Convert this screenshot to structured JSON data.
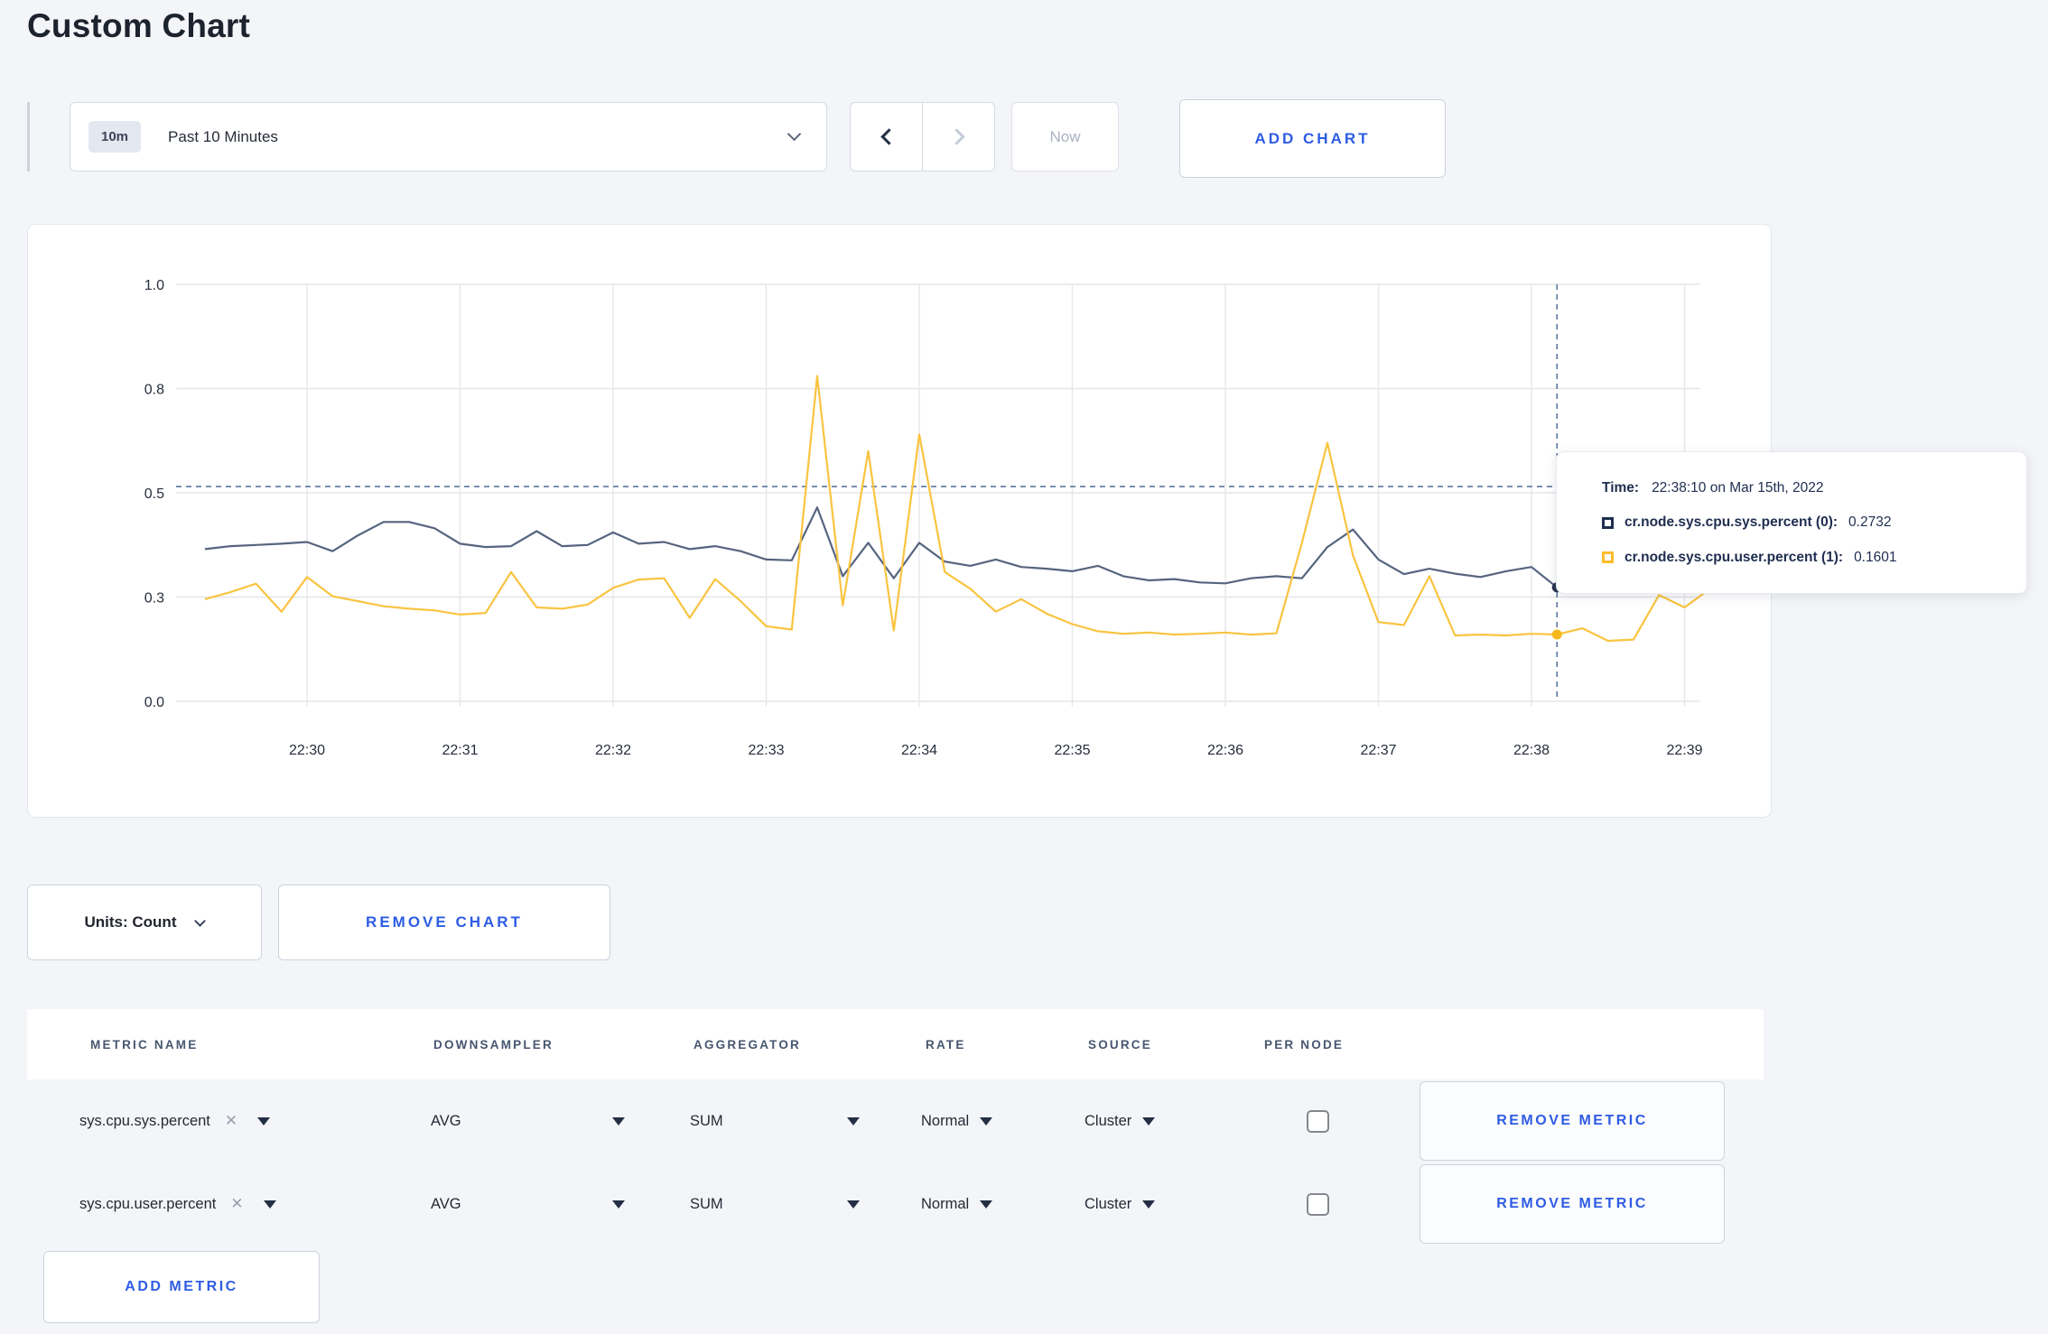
{
  "page": {
    "title": "Custom Chart"
  },
  "toolbar": {
    "time_badge": "10m",
    "time_label": "Past 10 Minutes",
    "now": "Now",
    "add_chart": "ADD CHART"
  },
  "chart_controls": {
    "units": "Units: Count",
    "remove_chart": "REMOVE CHART"
  },
  "tooltip": {
    "time_label": "Time:",
    "time_value": "22:38:10 on Mar 15th, 2022",
    "series": [
      {
        "name": "cr.node.sys.cpu.sys.percent (0):",
        "value": "0.2732",
        "color": "#1f2d50"
      },
      {
        "name": "cr.node.sys.cpu.user.percent (1):",
        "value": "0.1601",
        "color": "#fdbd2c"
      }
    ]
  },
  "chart_data": {
    "type": "line",
    "title": "",
    "xlabel": "",
    "ylabel": "",
    "ylim": [
      0,
      1
    ],
    "grid": true,
    "legend_position": "tooltip",
    "x_start": "22:29:20",
    "x_step_seconds": 10,
    "x_ticks": [
      "22:30",
      "22:31",
      "22:32",
      "22:33",
      "22:34",
      "22:35",
      "22:36",
      "22:37",
      "22:38",
      "22:39"
    ],
    "y_ticks": {
      "values": [
        0,
        0.25,
        0.5,
        0.75,
        1.0
      ],
      "labels": [
        "0.0",
        "0.3",
        "0.5",
        "0.8",
        "1.0"
      ]
    },
    "series": [
      {
        "name": "cr.node.sys.cpu.sys.percent",
        "color": "#56647f",
        "dot_color": "#26334f",
        "values": [
          0.365,
          0.372,
          0.375,
          0.378,
          0.382,
          0.36,
          0.398,
          0.43,
          0.43,
          0.415,
          0.378,
          0.37,
          0.372,
          0.408,
          0.372,
          0.375,
          0.405,
          0.378,
          0.382,
          0.365,
          0.372,
          0.36,
          0.34,
          0.338,
          0.465,
          0.3,
          0.38,
          0.295,
          0.38,
          0.335,
          0.325,
          0.34,
          0.322,
          0.318,
          0.312,
          0.325,
          0.3,
          0.29,
          0.293,
          0.285,
          0.283,
          0.295,
          0.3,
          0.295,
          0.37,
          0.412,
          0.34,
          0.305,
          0.318,
          0.306,
          0.298,
          0.312,
          0.322,
          0.2732,
          0.3,
          0.302,
          0.298,
          0.303,
          0.3,
          0.305
        ]
      },
      {
        "name": "cr.node.sys.cpu.user.percent",
        "color": "#f9c440",
        "dot_color": "#f5b91c",
        "values": [
          0.245,
          0.262,
          0.282,
          0.215,
          0.298,
          0.252,
          0.24,
          0.228,
          0.222,
          0.218,
          0.208,
          0.212,
          0.31,
          0.225,
          0.222,
          0.232,
          0.272,
          0.292,
          0.295,
          0.2,
          0.293,
          0.24,
          0.18,
          0.172,
          0.78,
          0.23,
          0.6,
          0.17,
          0.64,
          0.31,
          0.27,
          0.215,
          0.245,
          0.21,
          0.185,
          0.168,
          0.162,
          0.165,
          0.16,
          0.162,
          0.165,
          0.16,
          0.163,
          0.38,
          0.62,
          0.35,
          0.19,
          0.183,
          0.3,
          0.158,
          0.16,
          0.158,
          0.162,
          0.1601,
          0.175,
          0.145,
          0.148,
          0.255,
          0.225,
          0.27
        ]
      }
    ],
    "hover": {
      "index": 53,
      "time": "22:38:10",
      "h_line_value": 0.515
    }
  },
  "metrics_table": {
    "headers": [
      "METRIC NAME",
      "DOWNSAMPLER",
      "AGGREGATOR",
      "RATE",
      "SOURCE",
      "PER NODE"
    ],
    "rows": [
      {
        "metric": "sys.cpu.sys.percent",
        "downsampler": "AVG",
        "aggregator": "SUM",
        "rate": "Normal",
        "source": "Cluster",
        "per_node": false,
        "remove": "REMOVE METRIC"
      },
      {
        "metric": "sys.cpu.user.percent",
        "downsampler": "AVG",
        "aggregator": "SUM",
        "rate": "Normal",
        "source": "Cluster",
        "per_node": false,
        "remove": "REMOVE METRIC"
      }
    ],
    "add_metric": "ADD METRIC"
  }
}
